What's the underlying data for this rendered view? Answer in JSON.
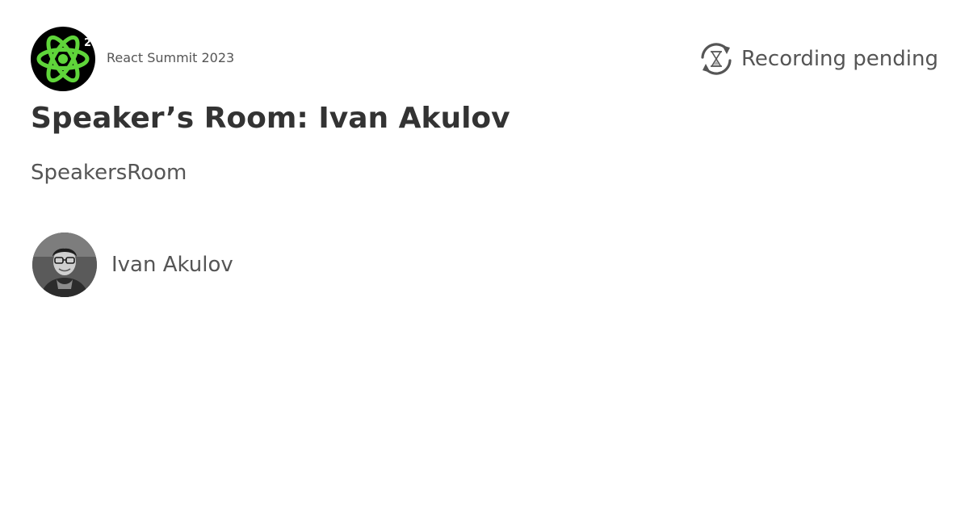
{
  "event": {
    "name": "React Summit 2023",
    "logo_icon": "react-atom-logo",
    "logo_badge": "2",
    "logo_color": "#5fd53a"
  },
  "status": {
    "label": "Recording pending",
    "icon": "hourglass-sync-icon"
  },
  "talk": {
    "title": "Speaker’s Room: Ivan Akulov",
    "track": "SpeakersRoom"
  },
  "speakers": [
    {
      "name": "Ivan Akulov",
      "avatar": "speaker-photo"
    }
  ],
  "colors": {
    "text_primary": "#333333",
    "text_secondary": "#555555",
    "background": "#ffffff"
  }
}
